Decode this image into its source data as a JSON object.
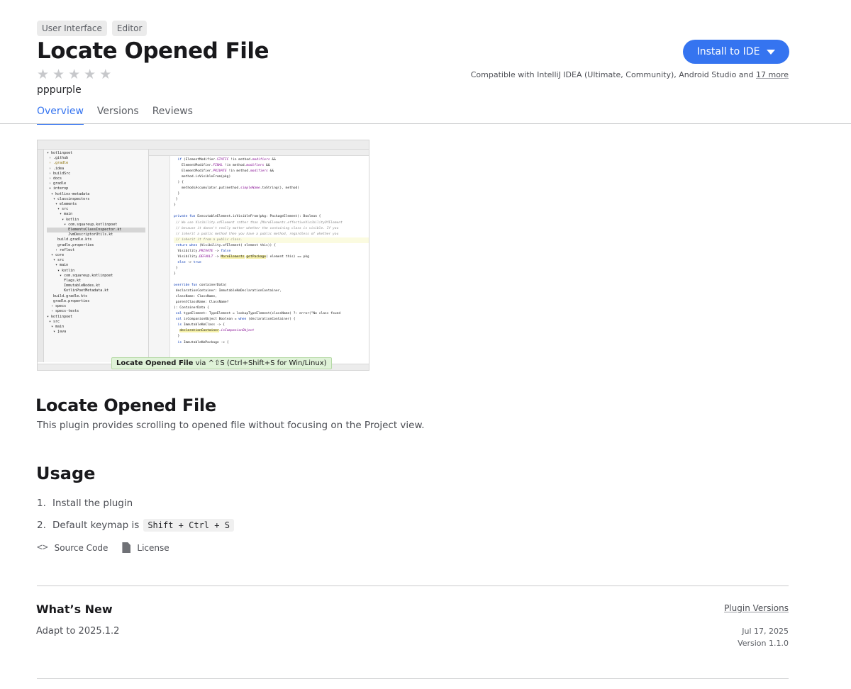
{
  "tags": [
    "User Interface",
    "Editor"
  ],
  "plugin": {
    "title": "Locate Opened File",
    "vendor": "pppurple",
    "rating_stars": 0
  },
  "install": {
    "button_label": "Install to IDE",
    "compat_text": "Compatible with IntelliJ IDEA (Ultimate, Community), Android Studio and",
    "compat_more": "17 more"
  },
  "tabs": [
    "Overview",
    "Versions",
    "Reviews"
  ],
  "screenshot": {
    "overlay_bold": "Locate Opened File",
    "overlay_rest": " via ^⇧S (Ctrl+Shift+S for Win/Linux)"
  },
  "overview": {
    "heading": "Locate Opened File",
    "description": "This plugin provides scrolling to opened file without focusing on the Project view."
  },
  "usage": {
    "heading": "Usage",
    "steps": [
      {
        "num": "1.",
        "text": "Install the plugin"
      },
      {
        "num": "2.",
        "text": "Default keymap is",
        "kbd": "Shift + Ctrl + S"
      }
    ]
  },
  "links": {
    "source_code": "Source Code",
    "license": "License"
  },
  "whats_new": {
    "heading": "What’s New",
    "text": "Adapt to 2025.1.2",
    "plugin_versions_link": "Plugin Versions",
    "date": "Jul 17, 2025",
    "version": "Version 1.1.0"
  },
  "colors": {
    "accent": "#3574f0",
    "text": "#27282c",
    "muted": "#4c4e54"
  }
}
